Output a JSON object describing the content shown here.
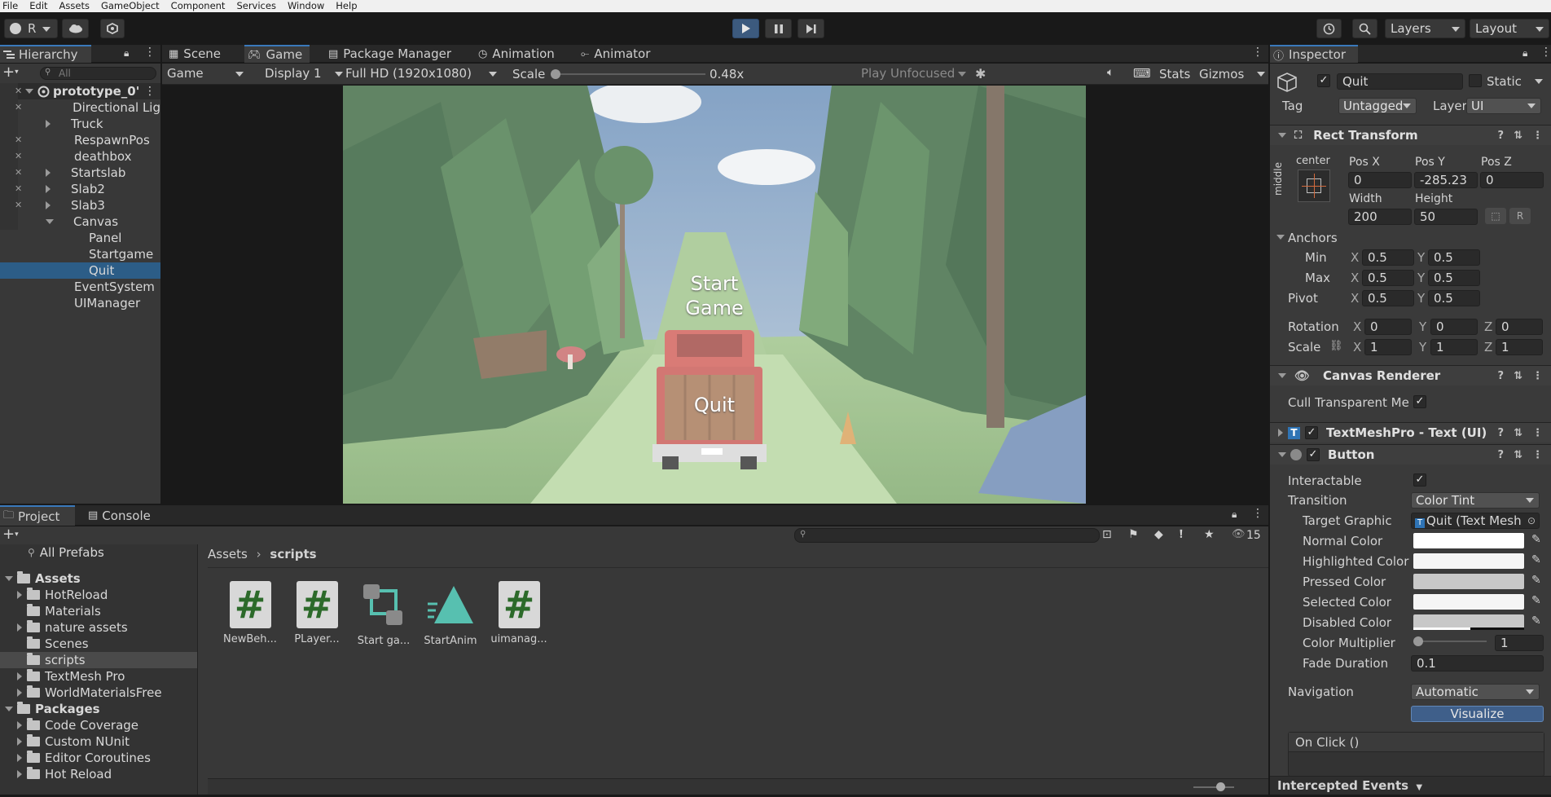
{
  "menu": [
    "File",
    "Edit",
    "Assets",
    "GameObject",
    "Component",
    "Services",
    "Window",
    "Help"
  ],
  "toolbar": {
    "account_label": "R",
    "layers_label": "Layers",
    "layout_label": "Layout"
  },
  "hierarchy": {
    "tab": "Hierarchy",
    "search_placeholder": "All",
    "items": [
      {
        "label": "prototype_0'"
      },
      {
        "label": "Directional Lig"
      },
      {
        "label": "Truck"
      },
      {
        "label": "RespawnPos"
      },
      {
        "label": "deathbox"
      },
      {
        "label": "Startslab"
      },
      {
        "label": "Slab2"
      },
      {
        "label": "Slab3"
      },
      {
        "label": "Canvas"
      },
      {
        "label": "Panel"
      },
      {
        "label": "Startgame"
      },
      {
        "label": "Quit"
      },
      {
        "label": "EventSystem"
      },
      {
        "label": "UIManager"
      }
    ]
  },
  "scene_tabs": [
    "Scene",
    "Game",
    "Package Manager",
    "Animation",
    "Animator"
  ],
  "game_toolbar": {
    "mode": "Game",
    "display": "Display 1",
    "resolution": "Full HD (1920x1080)",
    "scale_label": "Scale",
    "scale_value": "0.48x",
    "scale_fraction": 0.0,
    "play_mode": "Play Unfocused",
    "stats": "Stats",
    "gizmos": "Gizmos"
  },
  "game_view": {
    "start_text_line1": "Start",
    "start_text_line2": "Game",
    "quit_text": "Quit"
  },
  "project": {
    "tabs": [
      "Project",
      "Console"
    ],
    "count": "15",
    "breadcrumb": [
      "Assets",
      "scripts"
    ],
    "tree": [
      {
        "label": "All Prefabs"
      },
      {
        "label": "Assets"
      },
      {
        "label": "HotReload"
      },
      {
        "label": "Materials"
      },
      {
        "label": "nature assets"
      },
      {
        "label": "Scenes"
      },
      {
        "label": "scripts"
      },
      {
        "label": "TextMesh Pro"
      },
      {
        "label": "WorldMaterialsFree"
      },
      {
        "label": "Packages"
      },
      {
        "label": "Code Coverage"
      },
      {
        "label": "Custom NUnit"
      },
      {
        "label": "Editor Coroutines"
      },
      {
        "label": "Hot Reload"
      }
    ],
    "assets": [
      {
        "label": "NewBeh..."
      },
      {
        "label": "PLayer..."
      },
      {
        "label": "Start ga..."
      },
      {
        "label": "StartAnim"
      },
      {
        "label": "uimanag..."
      }
    ]
  },
  "inspector": {
    "tab": "Inspector",
    "object_name": "Quit",
    "static_label": "Static",
    "tag_label": "Tag",
    "tag_value": "Untagged",
    "layer_label": "Layer",
    "layer_value": "UI",
    "rect": {
      "title": "Rect Transform",
      "anchor_h": "center",
      "anchor_v": "middle",
      "posx_label": "Pos X",
      "posx": "0",
      "posy_label": "Pos Y",
      "posy": "-285.23",
      "posz_label": "Pos Z",
      "posz": "0",
      "width_label": "Width",
      "width": "200",
      "height_label": "Height",
      "height": "50",
      "anchors_label": "Anchors",
      "min_label": "Min",
      "min_x": "0.5",
      "min_y": "0.5",
      "max_label": "Max",
      "max_x": "0.5",
      "max_y": "0.5",
      "pivot_label": "Pivot",
      "pivot_x": "0.5",
      "pivot_y": "0.5",
      "rotation_label": "Rotation",
      "rot_x": "0",
      "rot_y": "0",
      "rot_z": "0",
      "scale_label": "Scale",
      "scale_x": "1",
      "scale_y": "1",
      "scale_z": "1",
      "x": "X",
      "y": "Y",
      "z": "Z",
      "blueprint_btn": "R"
    },
    "canvas_renderer": {
      "title": "Canvas Renderer",
      "cull_label": "Cull Transparent Me:"
    },
    "textmeshpro": {
      "title": "TextMeshPro - Text (UI)"
    },
    "button": {
      "title": "Button",
      "interactable_label": "Interactable",
      "transition_label": "Transition",
      "transition_value": "Color Tint",
      "target_graphic_label": "Target Graphic",
      "target_graphic_value": "Quit (Text Mesh",
      "normal_label": "Normal Color",
      "highlighted_label": "Highlighted Color",
      "pressed_label": "Pressed Color",
      "selected_label": "Selected Color",
      "disabled_label": "Disabled Color",
      "multiplier_label": "Color Multiplier",
      "multiplier_value": "1",
      "multiplier_fraction": 0.0,
      "fade_label": "Fade Duration",
      "fade_value": "0.1",
      "navigation_label": "Navigation",
      "navigation_value": "Automatic",
      "visualize_label": "Visualize",
      "onclick_label": "On Click ()"
    },
    "intercepted_label": "Intercepted Events"
  },
  "colors": {
    "accent": "#3a79bb",
    "selection": "#2c5d87",
    "normal_color": "#ffffff",
    "highlighted_color": "#f5f5f5",
    "pressed_color": "#c8c8c8",
    "selected_color": "#f5f5f5",
    "disabled_color": "#c8c8c8"
  }
}
